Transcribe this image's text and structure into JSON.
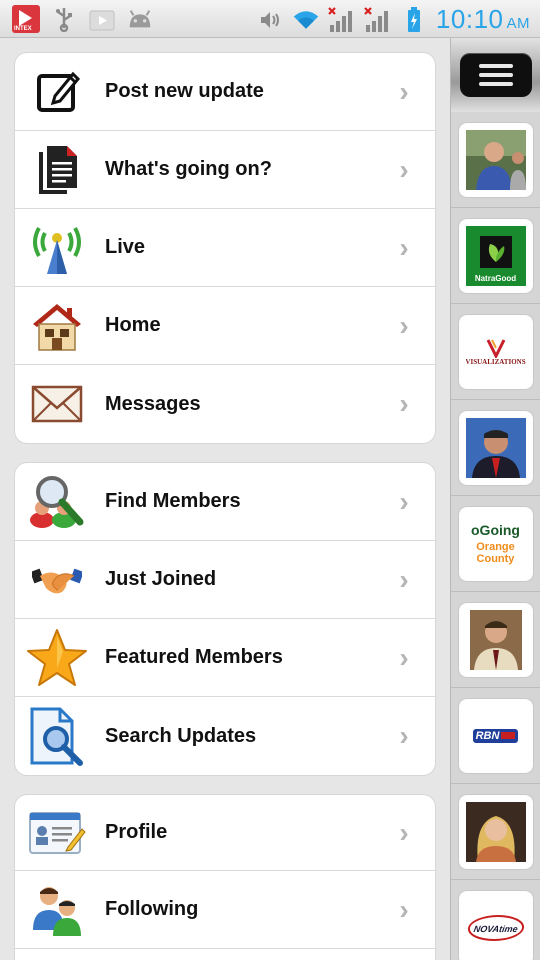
{
  "status_bar": {
    "time": "10:10",
    "ampm": "AM",
    "app_badge_text": "INTEX",
    "left_icons": [
      "intex-app-icon",
      "usb-icon",
      "play-store-icon",
      "android-icon"
    ],
    "right_icons": [
      "vibrate-icon",
      "wifi-icon",
      "signal-1-icon",
      "signal-2-icon",
      "battery-charging-icon"
    ]
  },
  "menu": {
    "group1": [
      {
        "label": "Post new update",
        "icon": "edit-icon"
      },
      {
        "label": "What's going on?",
        "icon": "documents-icon"
      },
      {
        "label": "Live",
        "icon": "antenna-icon"
      },
      {
        "label": "Home",
        "icon": "house-icon"
      },
      {
        "label": "Messages",
        "icon": "envelope-icon"
      }
    ],
    "group2": [
      {
        "label": "Find Members",
        "icon": "magnifier-people-icon"
      },
      {
        "label": "Just Joined",
        "icon": "handshake-icon"
      },
      {
        "label": "Featured Members",
        "icon": "star-icon"
      },
      {
        "label": "Search Updates",
        "icon": "document-search-icon"
      }
    ],
    "group3": [
      {
        "label": "Profile",
        "icon": "id-card-icon"
      },
      {
        "label": "Following",
        "icon": "users-icon"
      }
    ]
  },
  "rail": {
    "menu_button_icon": "hamburger-icon",
    "thumbnails": [
      {
        "kind": "photo",
        "text": ""
      },
      {
        "kind": "logo",
        "text": "NatraGood"
      },
      {
        "kind": "logo",
        "text": "VISUALIZATIONS"
      },
      {
        "kind": "photo",
        "text": ""
      },
      {
        "kind": "logo",
        "text": "oGoing",
        "text2": "Orange County"
      },
      {
        "kind": "photo",
        "text": ""
      },
      {
        "kind": "logo",
        "text": "RBN"
      },
      {
        "kind": "photo",
        "text": ""
      },
      {
        "kind": "logo",
        "text": "NOVAtime"
      }
    ]
  },
  "colors": {
    "clock": "#2aa4e8",
    "natragood_green": "#1a8a2e",
    "orange_county": "#f08c1a",
    "rbn_blue": "#1f3f9b"
  }
}
